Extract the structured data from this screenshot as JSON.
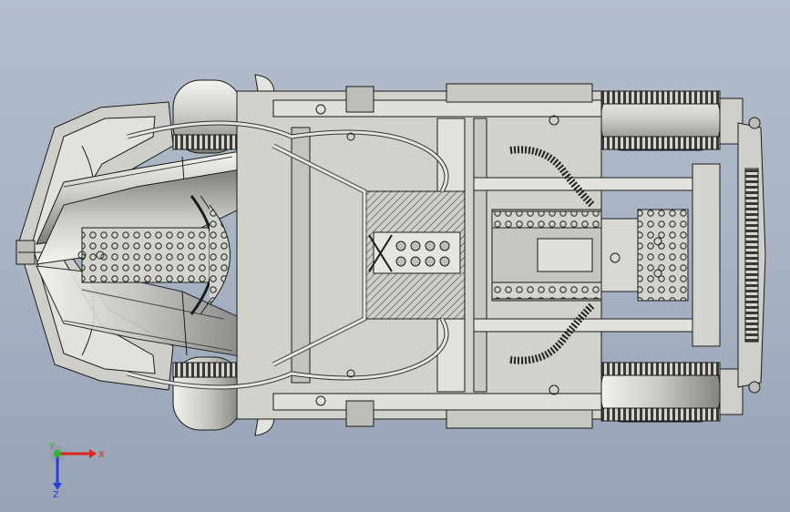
{
  "viewport": {
    "background_top": "#b4bdcb",
    "background_bottom": "#97a3b6"
  },
  "model": {
    "part_color": "#d9d9d4",
    "shade_color": "#9a9a94",
    "edge_color": "#1a1a1a"
  },
  "triad": {
    "x_label": "X",
    "y_label": "Y",
    "z_label": "Z",
    "x_color": "#e0241b",
    "y_color": "#2fb22f",
    "z_color": "#2a3fd8"
  }
}
